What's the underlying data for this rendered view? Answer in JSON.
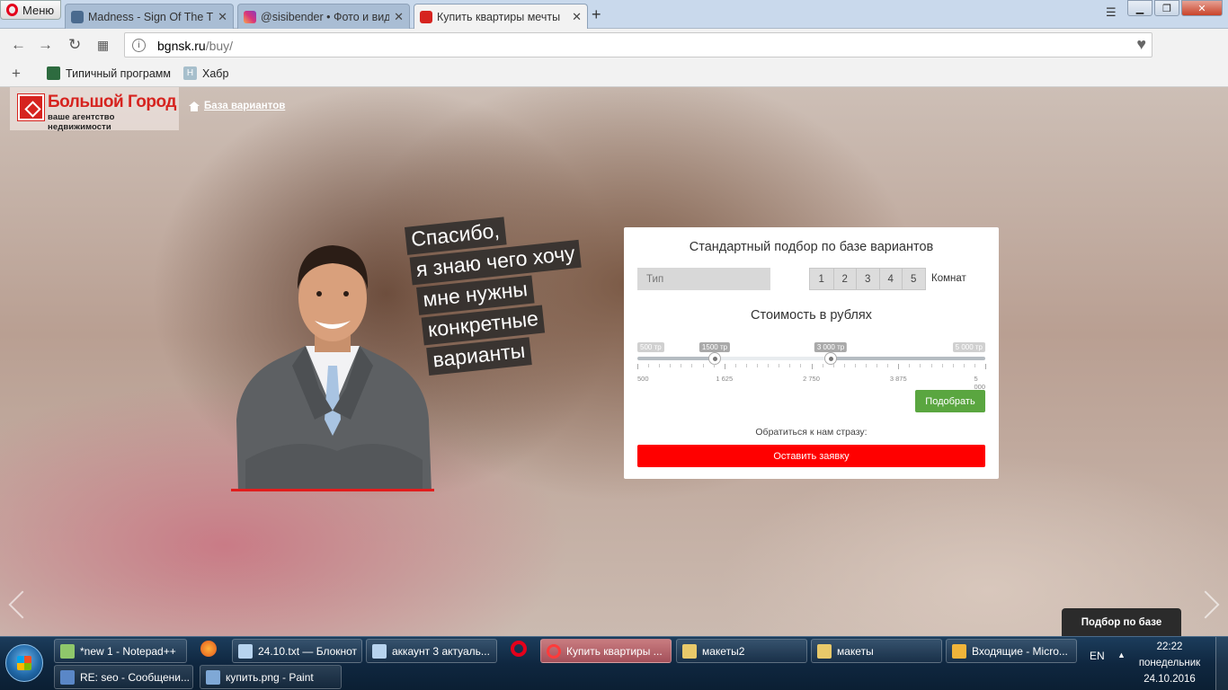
{
  "browser": {
    "menu_label": "Меню",
    "tabs": [
      {
        "title": "Madness - Sign Of The Tim"
      },
      {
        "title": "@sisibender • Фото и вид"
      },
      {
        "title": "Купить квартиры мечты"
      }
    ],
    "url_host": "bgnsk.ru",
    "url_path": "/buy/",
    "bookmarks": [
      {
        "label": "Типичный программ"
      },
      {
        "label": "Хабр"
      }
    ]
  },
  "site": {
    "logo_title": "Большой Город",
    "logo_subtitle": "ваше агентство недвижимости",
    "breadcrumb": "База вариантов",
    "speech_lines": [
      "Спасибо,",
      "я знаю чего хочу",
      "мне нужны",
      "конкретные",
      "варианты"
    ],
    "side_tab": "Подбор по базе",
    "colors": {
      "brand_red": "#d6231f",
      "pick_green": "#5aa640",
      "request_red": "#ff0000"
    }
  },
  "form": {
    "title": "Стандартный подбор по базе вариантов",
    "type_placeholder": "Тип",
    "rooms": [
      "1",
      "2",
      "3",
      "4",
      "5"
    ],
    "rooms_label": "Комнат",
    "price_title": "Стоимость в рублях",
    "slider": {
      "min": 500,
      "max": 5000,
      "min_label": "500 тр",
      "max_label": "5 000 тр",
      "low": 1500,
      "high": 3000,
      "low_label": "1500 тр",
      "high_label": "3 000 тр",
      "scale": [
        "500",
        "1 625",
        "2 750",
        "3 875",
        "5 000"
      ]
    },
    "pick_button": "Подобрать",
    "contact_text": "Обратиться к нам стразу:",
    "request_button": "Оставить заявку"
  },
  "taskbar": {
    "items": [
      {
        "label": "*new 1 - Notepad++"
      },
      {
        "label": "24.10.txt — Блокнот"
      },
      {
        "label": "аккаунт 3 актуаль..."
      },
      {
        "label": "Купить квартиры ..."
      },
      {
        "label": "макеты2"
      },
      {
        "label": "макеты"
      },
      {
        "label": "Входящие - Micro..."
      },
      {
        "label": "RE: seo - Сообщени..."
      },
      {
        "label": "купить.png - Paint"
      }
    ],
    "lang": "EN",
    "time": "22:22",
    "weekday": "понедельник",
    "date": "24.10.2016"
  }
}
